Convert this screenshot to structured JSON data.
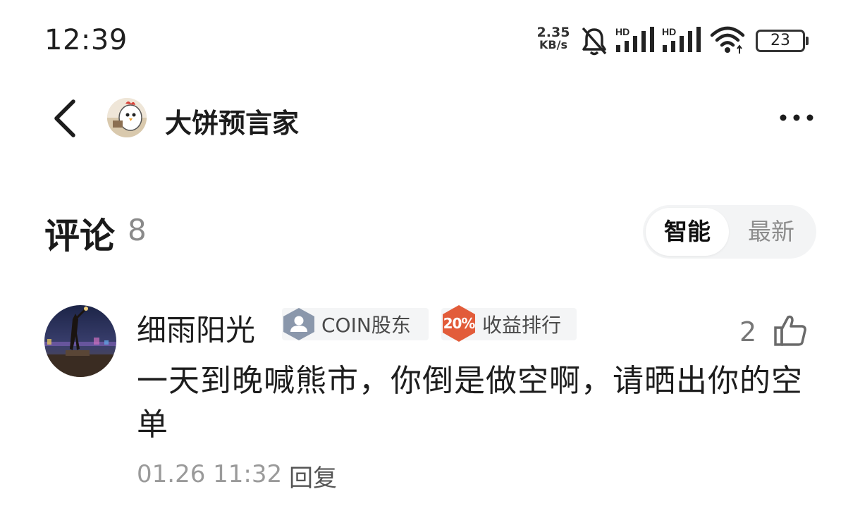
{
  "status_bar": {
    "time": "12:39",
    "net_speed_value": "2.35",
    "net_speed_unit": "KB/s",
    "signal1_label": "HD",
    "signal2_label": "HD",
    "battery": "23",
    "icons": [
      "bell-off-icon",
      "signal-icon",
      "signal-icon",
      "wifi-icon",
      "battery-icon"
    ]
  },
  "header": {
    "author_name": "大饼预言家",
    "icons": [
      "back-icon",
      "avatar",
      "more-icon"
    ]
  },
  "comments": {
    "title": "评论",
    "count": "8",
    "sort_options": [
      "智能",
      "最新"
    ],
    "active_sort": "智能",
    "items": [
      {
        "user": "细雨阳光",
        "badges": [
          {
            "icon": "user-icon",
            "label": "COIN股东"
          },
          {
            "icon_text": "20%",
            "label": "收益排行"
          }
        ],
        "likes": "2",
        "text": "一天到晚喊熊市，你倒是做空啊，请晒出你的空单",
        "time": "01.26 11:32",
        "reply_label": "回复"
      }
    ]
  },
  "colors": {
    "badge_holder_icon": "#8a97ab",
    "badge_rank_icon": "#e25c3a",
    "sort_bg": "#f3f4f5"
  }
}
